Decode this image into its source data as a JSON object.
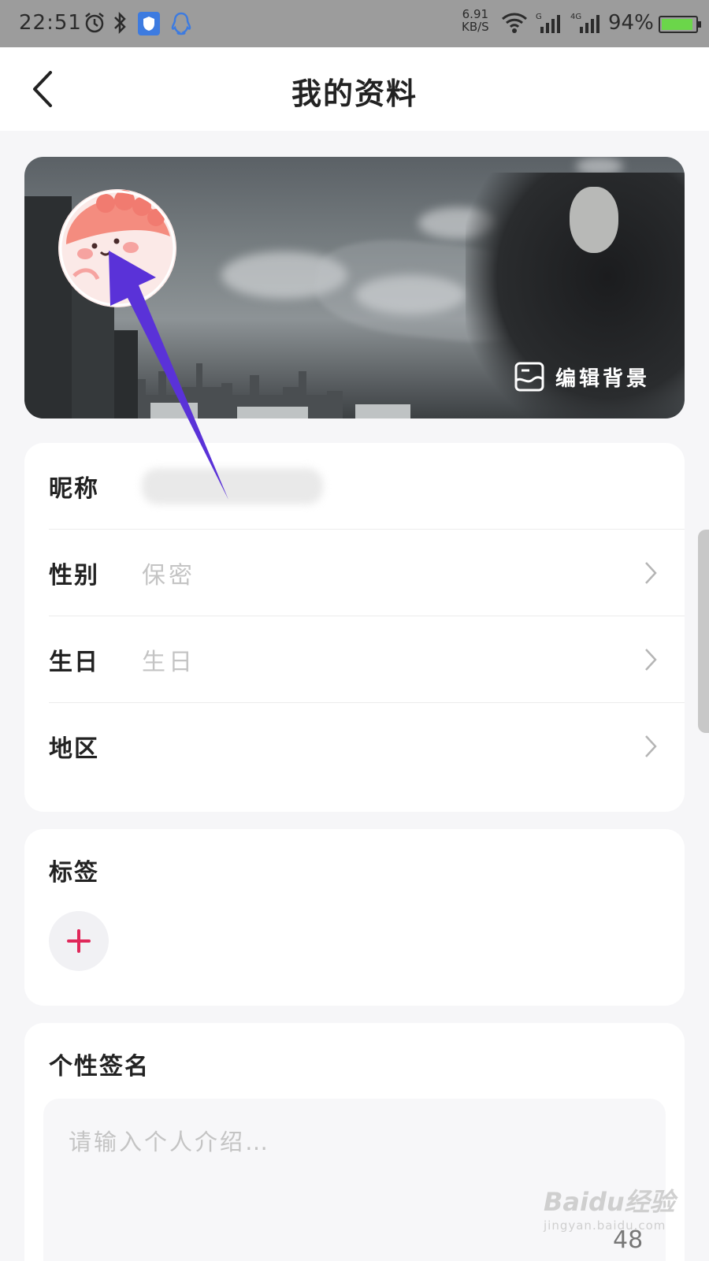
{
  "status_bar": {
    "time": "22:51",
    "net_speed": "6.91",
    "net_unit": "KB/S",
    "battery_percent": "94%",
    "battery_level": 0.94,
    "icons": [
      "alarm-icon",
      "bluetooth-icon",
      "shield-icon",
      "qq-icon",
      "wifi-icon",
      "signal-g-icon",
      "signal-4g-icon",
      "battery-icon"
    ]
  },
  "header": {
    "title": "我的资料"
  },
  "banner": {
    "edit_background_label": "编辑背景"
  },
  "profile": {
    "rows": [
      {
        "label": "昵称",
        "value": ""
      },
      {
        "label": "性别",
        "value": "保密"
      },
      {
        "label": "生日",
        "value": "生日"
      },
      {
        "label": "地区",
        "value": ""
      }
    ]
  },
  "tags": {
    "title": "标签"
  },
  "signature": {
    "title": "个性签名",
    "placeholder": "请输入个人介绍…",
    "counter": "48"
  },
  "watermark": {
    "main": "Baidu经验",
    "sub": "jingyan.baidu.com"
  },
  "colors": {
    "accent_plus": "#e0285a",
    "arrow": "#5a32d8",
    "status_bar_bg": "#9c9c9c",
    "battery_fill": "#6bd64a"
  }
}
